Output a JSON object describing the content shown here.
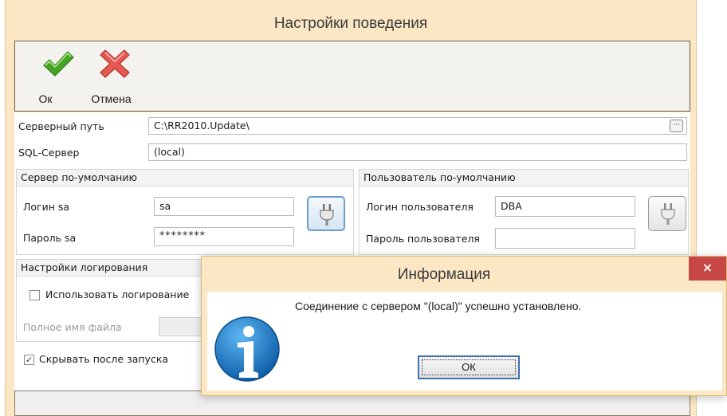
{
  "main_window": {
    "title": "Настройки поведения"
  },
  "toolbar": {
    "ok_label": "Ок",
    "cancel_label": "Отмена"
  },
  "fields": {
    "server_path_label": "Серверный путь",
    "server_path_value": "C:\\RR2010.Update\\",
    "browse_label": "···",
    "sql_server_label": "SQL-Сервер",
    "sql_server_value": "(local)"
  },
  "default_server": {
    "title": "Сервер по-умолчанию",
    "login_label": "Логин sa",
    "login_value": "sa",
    "password_label": "Пароль sa",
    "password_value": "********"
  },
  "default_user": {
    "title": "Пользователь по-умолчанию",
    "login_label": "Логин пользователя",
    "login_value": "DBA",
    "password_label": "Пароль пользователя",
    "password_value": ""
  },
  "logging": {
    "title": "Настройки логирования",
    "use_logging_label": "Использовать логирование",
    "use_logging_checked": false,
    "filename_label": "Полное имя файла"
  },
  "hide_after_launch": {
    "label": "Скрывать после запуска",
    "checked": true,
    "mark": "✓"
  },
  "dialog": {
    "title": "Информация",
    "close_glyph": "×",
    "message": "Соединение с сервером \"(local)\" успешно установлено.",
    "ok_label": "ОК",
    "icon": "information-icon"
  },
  "colors": {
    "window_bg": "#fbe7c4",
    "close_red": "#c74646",
    "info_blue": "#1673c3",
    "ok_green": "#45a325",
    "cancel_red": "#e25a52"
  }
}
